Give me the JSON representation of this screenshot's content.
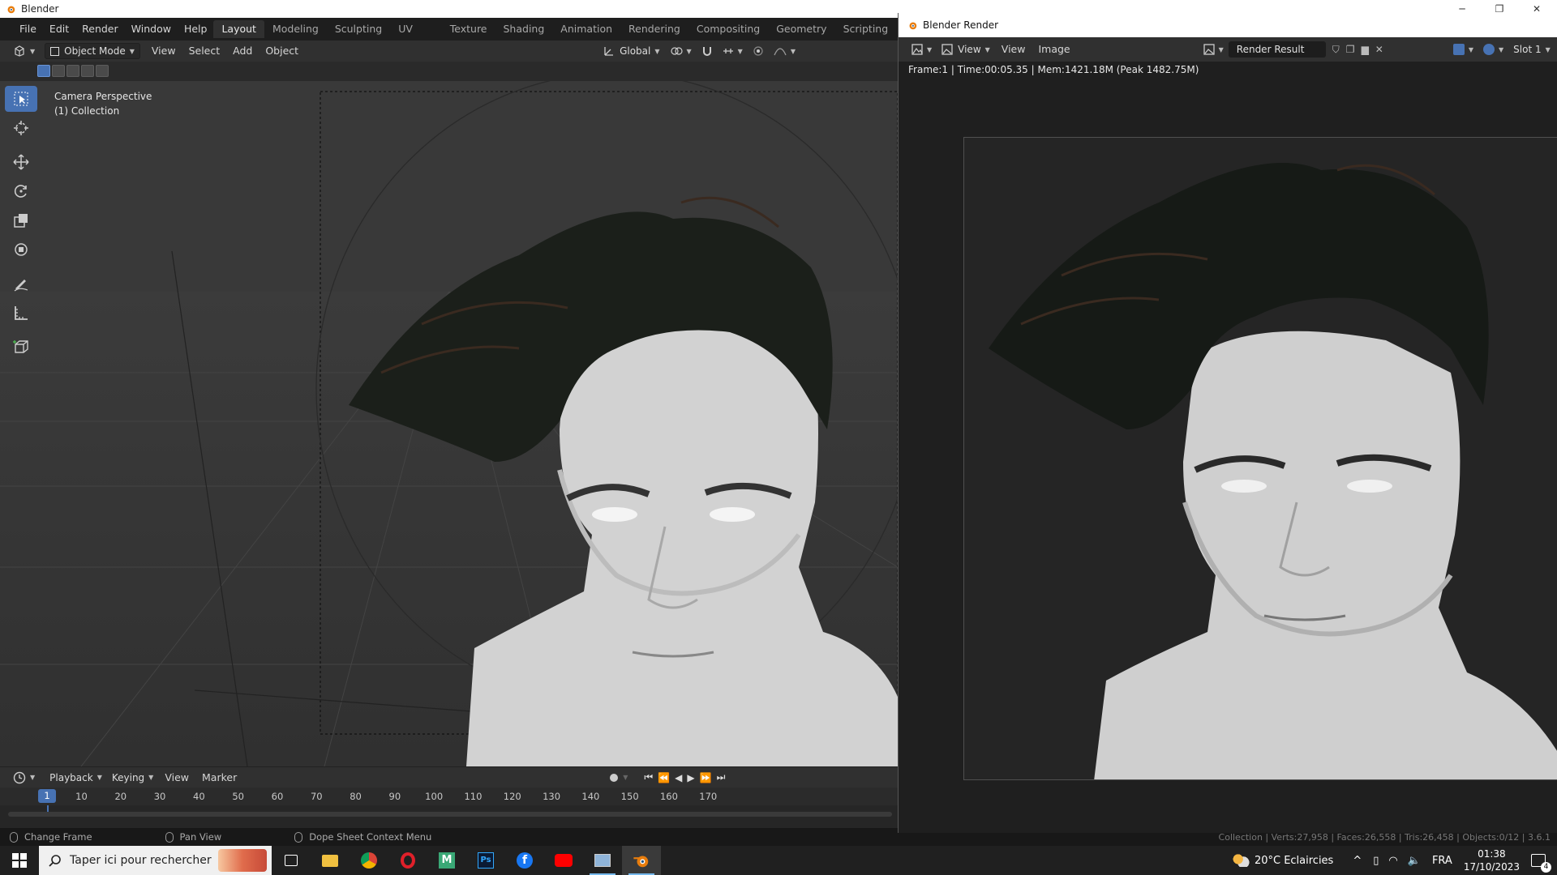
{
  "window": {
    "title": "Blender",
    "render_title": "Blender Render"
  },
  "menus": [
    "File",
    "Edit",
    "Render",
    "Window",
    "Help"
  ],
  "workspaces": [
    "Layout",
    "Modeling",
    "Sculpting",
    "UV Editing",
    "Texture Paint",
    "Shading",
    "Animation",
    "Rendering",
    "Compositing",
    "Geometry Nodes",
    "Scripting"
  ],
  "workspace_add": "+",
  "viewport_header": {
    "mode": "Object Mode",
    "menus": [
      "View",
      "Select",
      "Add",
      "Object"
    ],
    "transform_orientation": "Global"
  },
  "viewport": {
    "camera_label": "Camera Perspective",
    "collection_label": "(1) Collection"
  },
  "timeline": {
    "menus": [
      "Playback",
      "Keying",
      "View",
      "Marker"
    ],
    "current_frame": "1",
    "ticks": [
      "10",
      "20",
      "30",
      "40",
      "50",
      "60",
      "70",
      "80",
      "90",
      "100",
      "110",
      "120",
      "130",
      "140",
      "150",
      "160",
      "170"
    ]
  },
  "statusbar": {
    "items": [
      "Change Frame",
      "Pan View",
      "Dope Sheet Context Menu"
    ],
    "scene_stats": "Collection | Verts:27,958 | Faces:26,558 | Tris:26,458 | Objects:0/12 | 3.6.1"
  },
  "render_window": {
    "menus": [
      "View",
      "View",
      "Image"
    ],
    "image_name": "Render Result",
    "slot": "Slot 1",
    "info": "Frame:1 | Time:00:05.35 | Mem:1421.18M (Peak 1482.75M)"
  },
  "taskbar": {
    "search_placeholder": "Taper ici pour rechercher",
    "weather": "20°C  Eclaircies",
    "language": "FRA",
    "time": "01:38",
    "date": "17/10/2023",
    "notification_count": "4"
  },
  "colors": {
    "accent": "#4772b3",
    "viewport_bg": "#393939",
    "header_bg": "#303030"
  }
}
